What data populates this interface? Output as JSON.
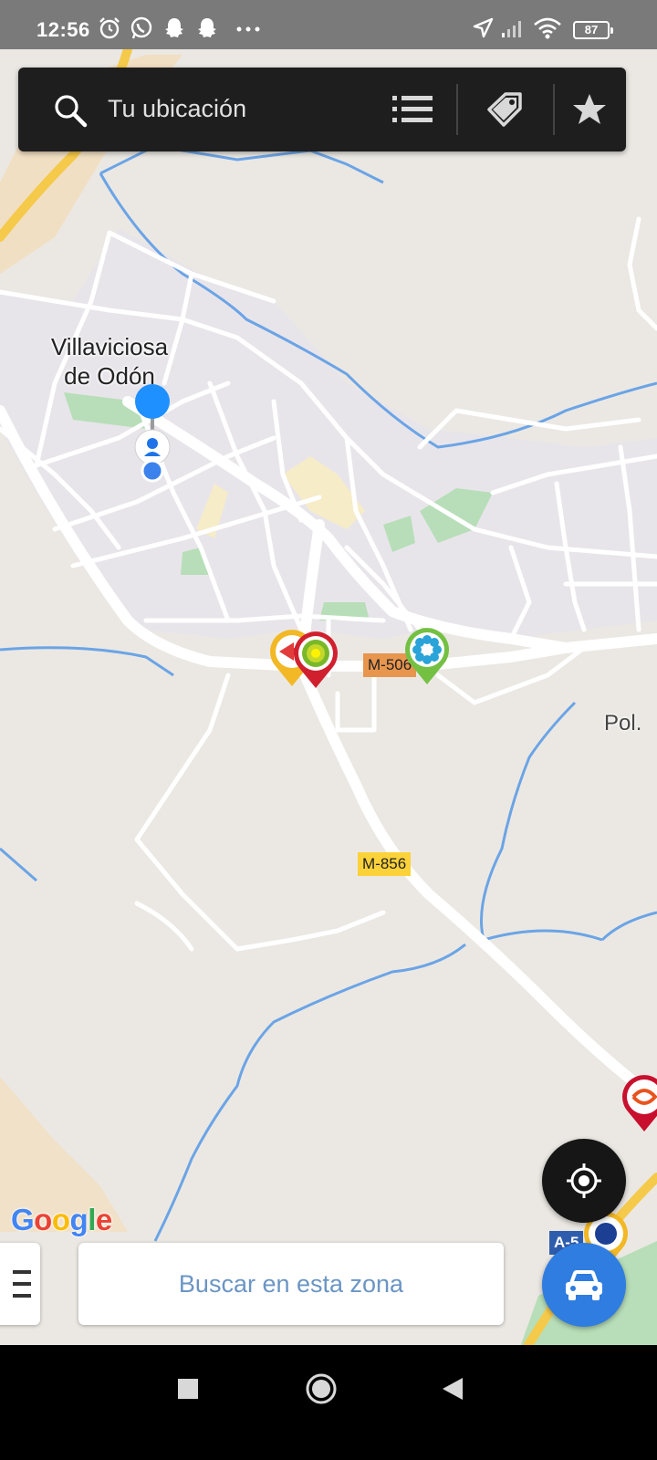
{
  "status_bar": {
    "time": "12:56",
    "battery": "87",
    "icons": [
      "alarm-icon",
      "whatsapp-icon",
      "snapchat-icon",
      "snapchat-icon",
      "more-dots-icon",
      "location-arrow-icon",
      "signal-icon",
      "wifi-icon",
      "battery-icon"
    ]
  },
  "search": {
    "placeholder": "Tu ubicación",
    "list_icon": "list-icon",
    "tag_icon": "tag-icon",
    "favorites_icon": "star-icon"
  },
  "map": {
    "town_label_line1": "Villaviciosa",
    "town_label_line2": "de Odón",
    "pol_label": "Pol.",
    "roads": {
      "m506": "M-506",
      "m856": "M-856",
      "a5": "A-5"
    },
    "colors": {
      "background": "#ebe8e3",
      "urban": "#e8e5ea",
      "park": "#b7deb8",
      "water": "#6ba4e6",
      "highway": "#f5c94a"
    },
    "markers": [
      "fuel-station-marker-red-yellow",
      "bp-station-marker",
      "blue-flower-station-marker",
      "red-station-marker",
      "blue-station-marker"
    ],
    "user_location_icon": "user-location-icon"
  },
  "controls": {
    "search_zone_label": "Buscar en esta zona",
    "locate_icon": "crosshair-icon",
    "car_icon": "car-icon",
    "menu_icon": "menu-icon"
  },
  "google_logo": [
    "G",
    "o",
    "o",
    "g",
    "l",
    "e"
  ],
  "google_logo_colors": [
    "#4285f4",
    "#ea4335",
    "#fbbc05",
    "#4285f4",
    "#34a853",
    "#ea4335"
  ],
  "nav_bar": {
    "buttons": [
      "square-recents-icon",
      "circle-home-icon",
      "triangle-back-icon"
    ]
  }
}
